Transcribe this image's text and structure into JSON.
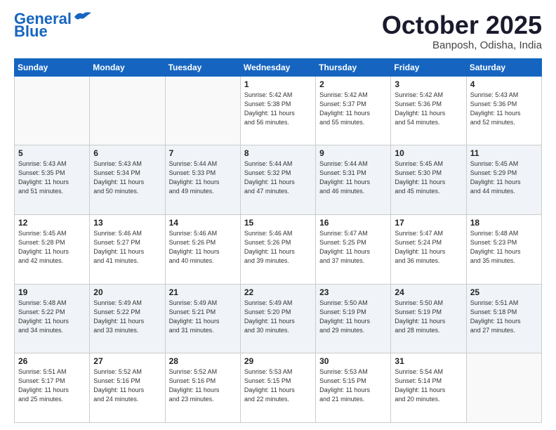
{
  "header": {
    "logo_line1": "General",
    "logo_line2": "Blue",
    "month": "October 2025",
    "location": "Banposh, Odisha, India"
  },
  "weekdays": [
    "Sunday",
    "Monday",
    "Tuesday",
    "Wednesday",
    "Thursday",
    "Friday",
    "Saturday"
  ],
  "weeks": [
    [
      {
        "day": "",
        "text": ""
      },
      {
        "day": "",
        "text": ""
      },
      {
        "day": "",
        "text": ""
      },
      {
        "day": "1",
        "text": "Sunrise: 5:42 AM\nSunset: 5:38 PM\nDaylight: 11 hours\nand 56 minutes."
      },
      {
        "day": "2",
        "text": "Sunrise: 5:42 AM\nSunset: 5:37 PM\nDaylight: 11 hours\nand 55 minutes."
      },
      {
        "day": "3",
        "text": "Sunrise: 5:42 AM\nSunset: 5:36 PM\nDaylight: 11 hours\nand 54 minutes."
      },
      {
        "day": "4",
        "text": "Sunrise: 5:43 AM\nSunset: 5:36 PM\nDaylight: 11 hours\nand 52 minutes."
      }
    ],
    [
      {
        "day": "5",
        "text": "Sunrise: 5:43 AM\nSunset: 5:35 PM\nDaylight: 11 hours\nand 51 minutes."
      },
      {
        "day": "6",
        "text": "Sunrise: 5:43 AM\nSunset: 5:34 PM\nDaylight: 11 hours\nand 50 minutes."
      },
      {
        "day": "7",
        "text": "Sunrise: 5:44 AM\nSunset: 5:33 PM\nDaylight: 11 hours\nand 49 minutes."
      },
      {
        "day": "8",
        "text": "Sunrise: 5:44 AM\nSunset: 5:32 PM\nDaylight: 11 hours\nand 47 minutes."
      },
      {
        "day": "9",
        "text": "Sunrise: 5:44 AM\nSunset: 5:31 PM\nDaylight: 11 hours\nand 46 minutes."
      },
      {
        "day": "10",
        "text": "Sunrise: 5:45 AM\nSunset: 5:30 PM\nDaylight: 11 hours\nand 45 minutes."
      },
      {
        "day": "11",
        "text": "Sunrise: 5:45 AM\nSunset: 5:29 PM\nDaylight: 11 hours\nand 44 minutes."
      }
    ],
    [
      {
        "day": "12",
        "text": "Sunrise: 5:45 AM\nSunset: 5:28 PM\nDaylight: 11 hours\nand 42 minutes."
      },
      {
        "day": "13",
        "text": "Sunrise: 5:46 AM\nSunset: 5:27 PM\nDaylight: 11 hours\nand 41 minutes."
      },
      {
        "day": "14",
        "text": "Sunrise: 5:46 AM\nSunset: 5:26 PM\nDaylight: 11 hours\nand 40 minutes."
      },
      {
        "day": "15",
        "text": "Sunrise: 5:46 AM\nSunset: 5:26 PM\nDaylight: 11 hours\nand 39 minutes."
      },
      {
        "day": "16",
        "text": "Sunrise: 5:47 AM\nSunset: 5:25 PM\nDaylight: 11 hours\nand 37 minutes."
      },
      {
        "day": "17",
        "text": "Sunrise: 5:47 AM\nSunset: 5:24 PM\nDaylight: 11 hours\nand 36 minutes."
      },
      {
        "day": "18",
        "text": "Sunrise: 5:48 AM\nSunset: 5:23 PM\nDaylight: 11 hours\nand 35 minutes."
      }
    ],
    [
      {
        "day": "19",
        "text": "Sunrise: 5:48 AM\nSunset: 5:22 PM\nDaylight: 11 hours\nand 34 minutes."
      },
      {
        "day": "20",
        "text": "Sunrise: 5:49 AM\nSunset: 5:22 PM\nDaylight: 11 hours\nand 33 minutes."
      },
      {
        "day": "21",
        "text": "Sunrise: 5:49 AM\nSunset: 5:21 PM\nDaylight: 11 hours\nand 31 minutes."
      },
      {
        "day": "22",
        "text": "Sunrise: 5:49 AM\nSunset: 5:20 PM\nDaylight: 11 hours\nand 30 minutes."
      },
      {
        "day": "23",
        "text": "Sunrise: 5:50 AM\nSunset: 5:19 PM\nDaylight: 11 hours\nand 29 minutes."
      },
      {
        "day": "24",
        "text": "Sunrise: 5:50 AM\nSunset: 5:19 PM\nDaylight: 11 hours\nand 28 minutes."
      },
      {
        "day": "25",
        "text": "Sunrise: 5:51 AM\nSunset: 5:18 PM\nDaylight: 11 hours\nand 27 minutes."
      }
    ],
    [
      {
        "day": "26",
        "text": "Sunrise: 5:51 AM\nSunset: 5:17 PM\nDaylight: 11 hours\nand 25 minutes."
      },
      {
        "day": "27",
        "text": "Sunrise: 5:52 AM\nSunset: 5:16 PM\nDaylight: 11 hours\nand 24 minutes."
      },
      {
        "day": "28",
        "text": "Sunrise: 5:52 AM\nSunset: 5:16 PM\nDaylight: 11 hours\nand 23 minutes."
      },
      {
        "day": "29",
        "text": "Sunrise: 5:53 AM\nSunset: 5:15 PM\nDaylight: 11 hours\nand 22 minutes."
      },
      {
        "day": "30",
        "text": "Sunrise: 5:53 AM\nSunset: 5:15 PM\nDaylight: 11 hours\nand 21 minutes."
      },
      {
        "day": "31",
        "text": "Sunrise: 5:54 AM\nSunset: 5:14 PM\nDaylight: 11 hours\nand 20 minutes."
      },
      {
        "day": "",
        "text": ""
      }
    ]
  ]
}
